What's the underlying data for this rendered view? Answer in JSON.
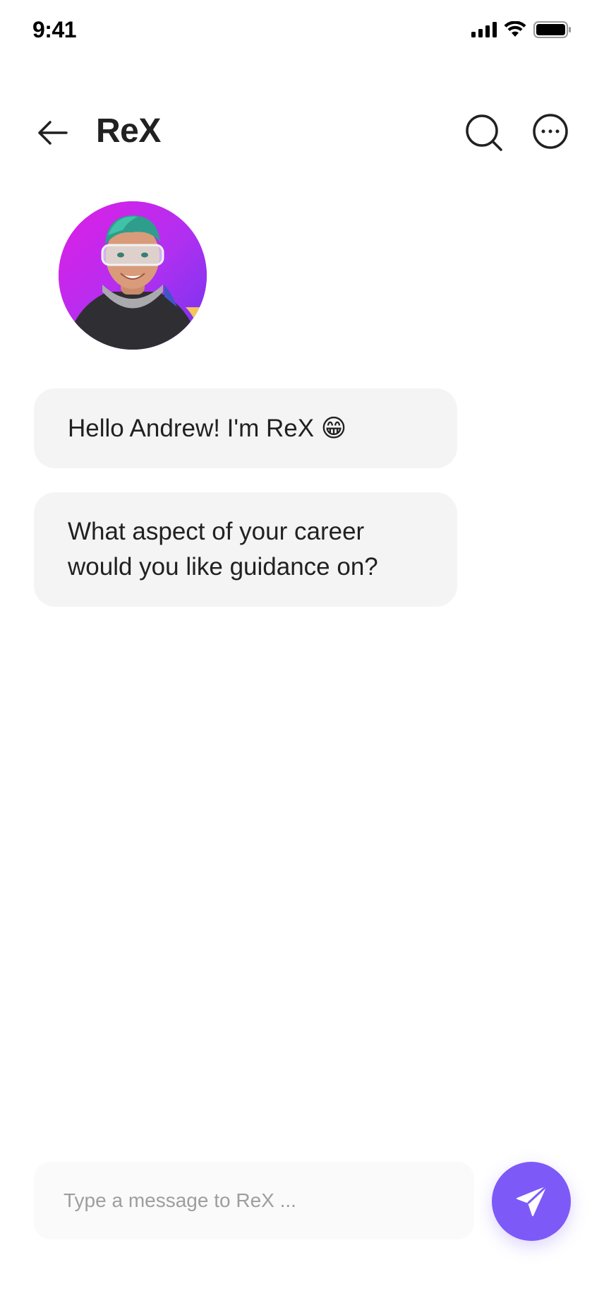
{
  "status_bar": {
    "time": "9:41",
    "icons": [
      "signal-icon",
      "wifi-icon",
      "battery-icon"
    ]
  },
  "header": {
    "title": "ReX",
    "back_icon": "arrow-left-icon",
    "search_icon": "search-icon",
    "more_icon": "more-horizontal-circle-icon"
  },
  "chat": {
    "avatar_icon": "bot-avatar",
    "messages": [
      {
        "sender": "ReX",
        "text": "Hello Andrew! I'm ReX 😁"
      },
      {
        "sender": "ReX",
        "text": "What aspect of your career would you like guidance on?"
      }
    ]
  },
  "composer": {
    "placeholder": "Type a message to ReX ...",
    "value": "",
    "send_icon": "send-icon"
  },
  "colors": {
    "accent": "#7d5af8",
    "bubble_bg": "#f4f4f4",
    "input_bg": "#fafafa",
    "text": "#212121",
    "placeholder": "#9e9e9e"
  }
}
